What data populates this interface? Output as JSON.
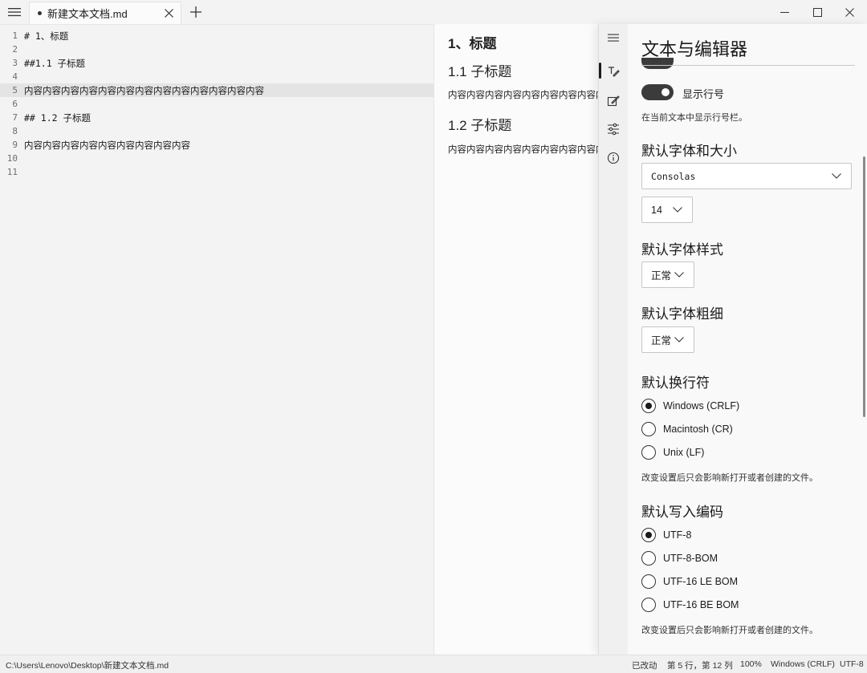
{
  "tab": {
    "title": "新建文本文档.md"
  },
  "editor": {
    "lines": [
      {
        "n": "1",
        "text": "# 1、标题"
      },
      {
        "n": "2",
        "text": ""
      },
      {
        "n": "3",
        "text": "##1.1 子标题"
      },
      {
        "n": "4",
        "text": ""
      },
      {
        "n": "5",
        "text": "内容内容内容内容内容内容内容内容内容内容内容内容内容"
      },
      {
        "n": "6",
        "text": ""
      },
      {
        "n": "7",
        "text": "## 1.2 子标题"
      },
      {
        "n": "8",
        "text": ""
      },
      {
        "n": "9",
        "text": "内容内容内容内容内容内容内容内容内容"
      },
      {
        "n": "10",
        "text": ""
      },
      {
        "n": "11",
        "text": ""
      }
    ],
    "active_line": 5
  },
  "preview": {
    "h1": "1、标题",
    "h2a": "1.1 子标题",
    "p1": "内容内容内容内容内容内容内容内容内容内容内容内容内容",
    "h2b": "1.2 子标题",
    "p2": "内容内容内容内容内容内容内容内容内容"
  },
  "settings": {
    "title": "文本与编辑器",
    "line_numbers": {
      "label": "显示行号",
      "desc": "在当前文本中显示行号栏。",
      "on": true
    },
    "font": {
      "heading": "默认字体和大小",
      "family": "Consolas",
      "size": "14"
    },
    "style": {
      "heading": "默认字体样式",
      "value": "正常"
    },
    "weight": {
      "heading": "默认字体粗细",
      "value": "正常"
    },
    "line_ending": {
      "heading": "默认换行符",
      "options": [
        "Windows (CRLF)",
        "Macintosh (CR)",
        "Unix (LF)"
      ],
      "selected": 0,
      "desc": "改变设置后只会影响新打开或者创建的文件。"
    },
    "encoding": {
      "heading": "默认写入编码",
      "options": [
        "UTF-8",
        "UTF-8-BOM",
        "UTF-16 LE BOM",
        "UTF-16 BE BOM"
      ],
      "selected": 0,
      "desc": "改变设置后只会影响新打开或者创建的文件。"
    },
    "rail_icons": [
      "hamburger-icon",
      "text-editor-icon",
      "personalize-icon",
      "advanced-sliders-icon",
      "info-icon"
    ]
  },
  "status": {
    "path": "C:\\Users\\Lenovo\\Desktop\\新建文本文档.md",
    "modified": "已改动",
    "position": "第 5 行，第 12 列",
    "zoom": "100%",
    "line_ending": "Windows (CRLF)",
    "encoding": "UTF-8"
  }
}
